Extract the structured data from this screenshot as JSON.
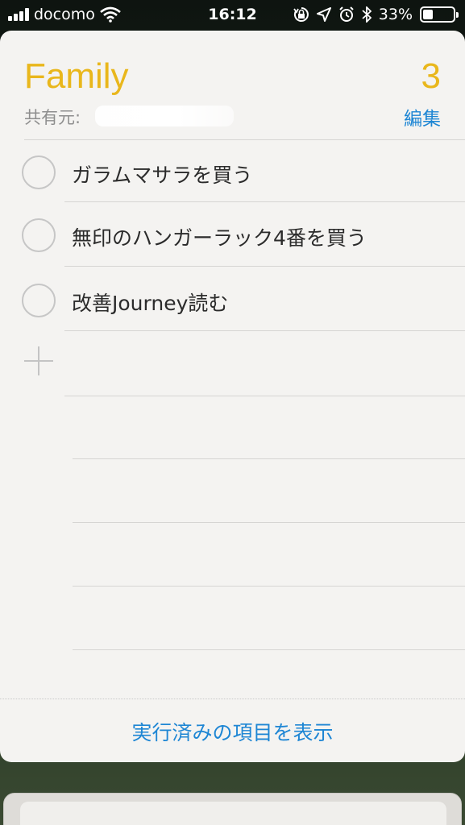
{
  "status_bar": {
    "carrier": "docomo",
    "time": "16:12",
    "battery_percent": "33%",
    "battery_level": 0.33,
    "icons": [
      "signal-icon",
      "wifi-icon",
      "orientation-lock-icon",
      "location-icon",
      "alarm-icon",
      "bluetooth-icon",
      "battery-icon"
    ]
  },
  "list": {
    "title": "Family",
    "count": "3",
    "shared_label": "共有元:",
    "edit_label": "編集",
    "accent_color": "#e9b71c",
    "link_color": "#1e86d4"
  },
  "items": [
    {
      "text": "ガラムマサラを買う",
      "completed": false
    },
    {
      "text": "無印のハンガーラック4番を買う",
      "completed": false
    },
    {
      "text": "改善Journey読む",
      "completed": false
    }
  ],
  "footer": {
    "show_completed_label": "実行済みの項目を表示"
  }
}
